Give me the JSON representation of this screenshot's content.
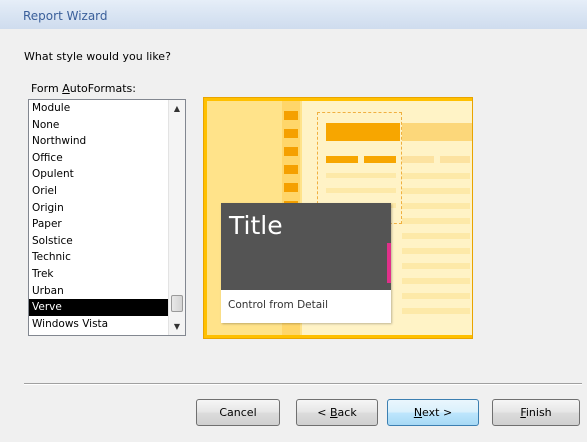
{
  "window": {
    "title": "Report Wizard"
  },
  "question": "What style would you like?",
  "autoformats": {
    "label_prefix": "Form ",
    "label_accel": "A",
    "label_rest": "utoFormats:",
    "items": [
      "Module",
      "None",
      "Northwind",
      "Office",
      "Opulent",
      "Oriel",
      "Origin",
      "Paper",
      "Solstice",
      "Technic",
      "Trek",
      "Urban",
      "Verve",
      "Windows Vista"
    ],
    "selected": "Verve"
  },
  "preview": {
    "title_text": "Title",
    "control_text": "Control from Detail",
    "colors": {
      "accent": "#ffc000",
      "header": "#545454",
      "highlight": "#e0308a"
    }
  },
  "buttons": {
    "cancel": "Cancel",
    "back_prefix": "< ",
    "back_accel": "B",
    "back_rest": "ack",
    "next_accel": "N",
    "next_rest": "ext >",
    "finish_accel": "F",
    "finish_rest": "inish"
  }
}
